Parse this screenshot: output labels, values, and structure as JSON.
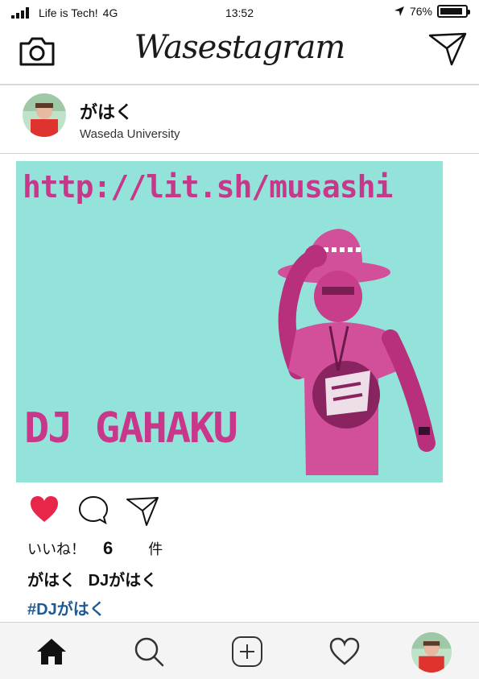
{
  "status_bar": {
    "carrier": "Life is Tech!",
    "network": "4G",
    "time": "13:52",
    "battery": "76%",
    "battery_level": 0.76
  },
  "header": {
    "title": "Wasestagram",
    "left_icon": "camera-icon",
    "right_icon": "send-icon"
  },
  "post": {
    "username": "がはく",
    "location": "Waseda University",
    "image_text": {
      "url": "http://lit.sh/musashi",
      "name": "DJ GAHAKU"
    },
    "liked": true,
    "likes_prefix": "いいね！",
    "likes_count": "6",
    "likes_suffix": "件",
    "caption_user": "がはく",
    "caption_text": "DJがはく",
    "hashtag": "#DJがはく"
  },
  "colors": {
    "photo_bg": "#94e3db",
    "photo_accent": "#c8378a",
    "like_red": "#e8264a",
    "hashtag": "#1f5b92"
  },
  "tab_bar": {
    "items": [
      "home-icon",
      "search-icon",
      "add-icon",
      "heart-icon",
      "profile-avatar"
    ]
  }
}
